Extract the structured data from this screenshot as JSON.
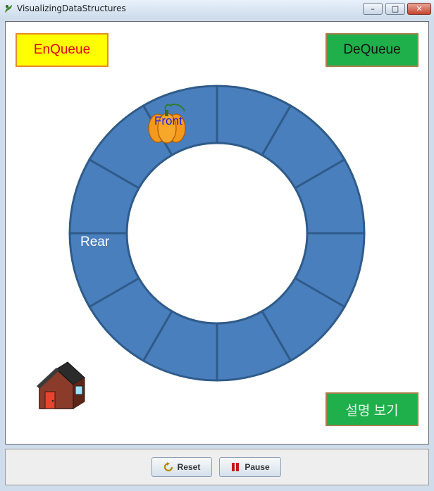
{
  "window": {
    "title": "VisualizingDataStructures",
    "buttons": {
      "minimize": "–",
      "maximize": "□",
      "close": "✕"
    }
  },
  "canvas": {
    "enqueue_label": "EnQueue",
    "dequeue_label": "DeQueue",
    "explain_label": "설명 보기",
    "front_label": "Front",
    "rear_label": "Rear",
    "queue_slots": 12,
    "colors": {
      "ring_fill": "#4a7fbd",
      "ring_stroke": "#2f5b8a"
    }
  },
  "controls": {
    "reset_label": "Reset",
    "pause_label": "Pause",
    "icons": {
      "reset": "refresh-icon",
      "pause": "pause-icon"
    }
  }
}
